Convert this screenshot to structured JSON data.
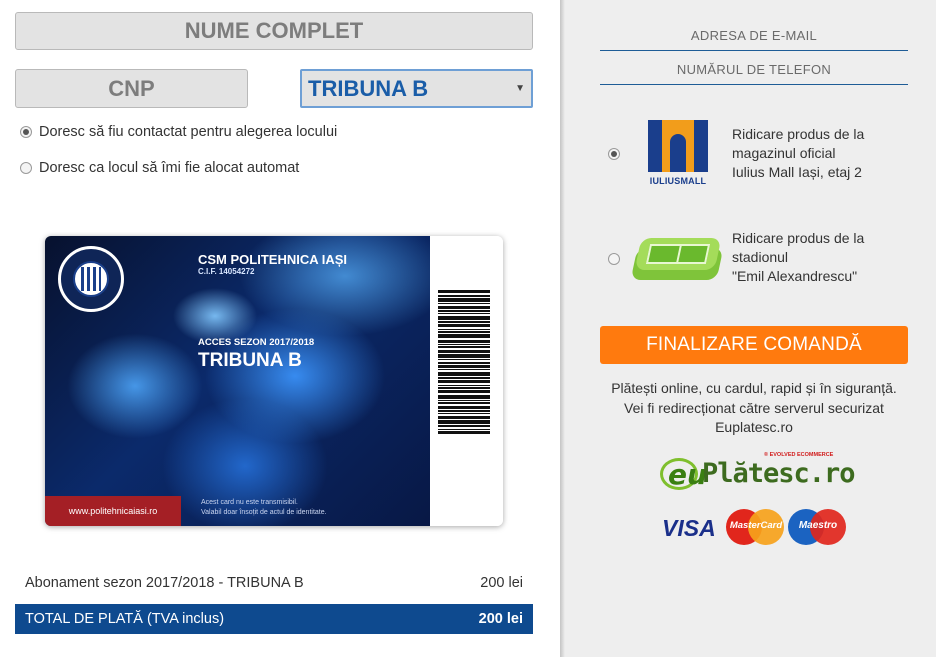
{
  "form": {
    "name_placeholder": "NUME COMPLET",
    "cnp_placeholder": "CNP",
    "tribune_selected": "TRIBUNA B",
    "seat_options": [
      {
        "label": "Doresc să fiu contactat pentru alegerea locului",
        "checked": true
      },
      {
        "label": "Doresc ca locul să îmi fie alocat automat",
        "checked": false
      }
    ]
  },
  "card": {
    "club": "CSM POLITEHNICA IAȘI",
    "cif": "C.I.F. 14054272",
    "access": "ACCES SEZON 2017/2018",
    "tribune": "TRIBUNA B",
    "url": "www.politehnicaiasi.ro",
    "note_line1": "Acest card nu este transmisibil.",
    "note_line2": "Valabil doar însoțit de actul de identitate."
  },
  "order": {
    "item_label": "Abonament sezon 2017/2018 - TRIBUNA B",
    "item_price": "200 lei",
    "total_label": "TOTAL DE PLATĂ (TVA inclus)",
    "total_price": "200 lei"
  },
  "contact": {
    "email_placeholder": "ADRESA DE E-MAIL",
    "phone_placeholder": "NUMĂRUL DE TELEFON"
  },
  "pickup": [
    {
      "line1": "Ridicare produs de la",
      "line2": "magazinul oficial",
      "line3": "Iulius Mall Iași, etaj 2",
      "checked": true,
      "logo": "IULIUSMALL"
    },
    {
      "line1": "Ridicare produs de la",
      "line2": "stadionul",
      "line3": "\"Emil Alexandrescu\"",
      "checked": false
    }
  ],
  "checkout": {
    "button_label": "FINALIZARE COMANDĂ",
    "info_line1": "Plătești online, cu cardul, rapid și în siguranță.",
    "info_line2": "Vei fi redirecționat către serverul securizat",
    "info_line3": "Euplatesc.ro"
  },
  "payment_logos": {
    "euplatesc_tag": "® EVOLVED ECOMMERCE",
    "euplatesc_text": "Plătesc.ro",
    "euplatesc_mark": "eu",
    "visa": "VISA",
    "mastercard": "MasterCard",
    "maestro": "Maestro"
  },
  "colors": {
    "accent_blue": "#0e4a8f",
    "order_button": "#ff7a0e",
    "panel_gray": "#eeeeee"
  }
}
